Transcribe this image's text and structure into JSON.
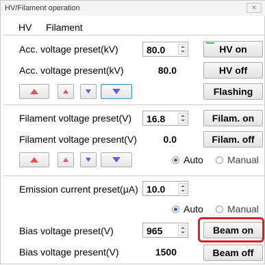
{
  "window": {
    "title": "HV/Filament operation",
    "close_glyph": "✕"
  },
  "menu": [
    "HV",
    "Filament"
  ],
  "hv": {
    "acc_preset_label": "Acc. voltage preset(kV)",
    "acc_preset_value": "80.0",
    "acc_present_label": "Acc. voltage present(kV)",
    "acc_present_value": "80.0",
    "hv_on": "HV on",
    "hv_off": "HV off",
    "flashing": "Flashing"
  },
  "filament": {
    "preset_label": "Filament voltage preset(V)",
    "preset_value": "16.8",
    "present_label": "Filament voltage present(V)",
    "present_value": "0.0",
    "fil_on": "Filam. on",
    "fil_off": "Filam. off",
    "auto": "Auto",
    "manual": "Manual"
  },
  "emission": {
    "preset_label": "Emission current preset(μA)",
    "preset_value": "10.0",
    "auto": "Auto",
    "manual": "Manual",
    "bias_preset_label": "Bias voltage preset(V)",
    "bias_preset_value": "965",
    "bias_present_label": "Bias voltage present(V)",
    "bias_present_value": "1500",
    "beam_on": "Beam on",
    "beam_off": "Beam off"
  },
  "colors": {
    "highlight": "#d6212a",
    "led": "#3ec44e",
    "arrow_up": "#e8505b",
    "arrow_down": "#6a5bd6"
  }
}
